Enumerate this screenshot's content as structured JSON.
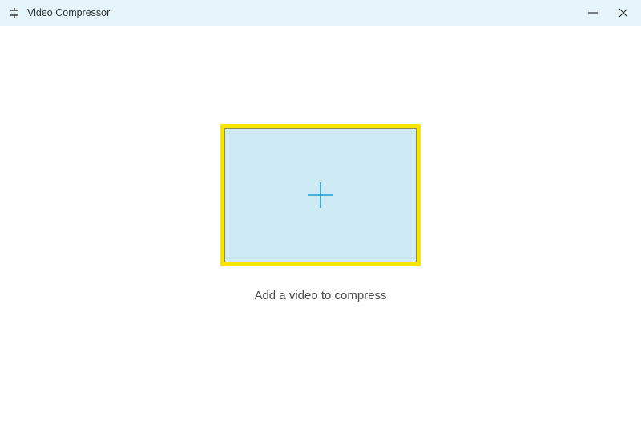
{
  "titlebar": {
    "app_title": "Video Compressor"
  },
  "main": {
    "prompt": "Add a video to compress"
  },
  "icons": {
    "app": "compressor-icon",
    "minimize": "minimize-icon",
    "close": "close-icon",
    "plus": "plus-icon"
  },
  "colors": {
    "titlebar_bg": "#e6f5fb",
    "dropzone_border": "#f7e500",
    "dropzone_fill": "#cdeaf5",
    "plus_stroke": "#1e9bc9"
  }
}
